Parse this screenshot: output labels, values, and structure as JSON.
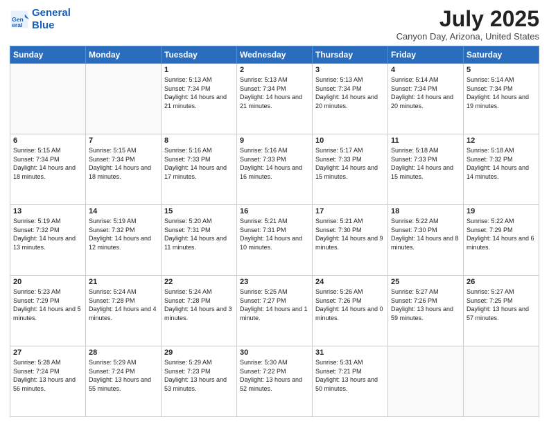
{
  "header": {
    "logo_line1": "General",
    "logo_line2": "Blue",
    "title": "July 2025",
    "subtitle": "Canyon Day, Arizona, United States"
  },
  "weekdays": [
    "Sunday",
    "Monday",
    "Tuesday",
    "Wednesday",
    "Thursday",
    "Friday",
    "Saturday"
  ],
  "weeks": [
    [
      {
        "day": "",
        "info": ""
      },
      {
        "day": "",
        "info": ""
      },
      {
        "day": "1",
        "info": "Sunrise: 5:13 AM\nSunset: 7:34 PM\nDaylight: 14 hours and 21 minutes."
      },
      {
        "day": "2",
        "info": "Sunrise: 5:13 AM\nSunset: 7:34 PM\nDaylight: 14 hours and 21 minutes."
      },
      {
        "day": "3",
        "info": "Sunrise: 5:13 AM\nSunset: 7:34 PM\nDaylight: 14 hours and 20 minutes."
      },
      {
        "day": "4",
        "info": "Sunrise: 5:14 AM\nSunset: 7:34 PM\nDaylight: 14 hours and 20 minutes."
      },
      {
        "day": "5",
        "info": "Sunrise: 5:14 AM\nSunset: 7:34 PM\nDaylight: 14 hours and 19 minutes."
      }
    ],
    [
      {
        "day": "6",
        "info": "Sunrise: 5:15 AM\nSunset: 7:34 PM\nDaylight: 14 hours and 18 minutes."
      },
      {
        "day": "7",
        "info": "Sunrise: 5:15 AM\nSunset: 7:34 PM\nDaylight: 14 hours and 18 minutes."
      },
      {
        "day": "8",
        "info": "Sunrise: 5:16 AM\nSunset: 7:33 PM\nDaylight: 14 hours and 17 minutes."
      },
      {
        "day": "9",
        "info": "Sunrise: 5:16 AM\nSunset: 7:33 PM\nDaylight: 14 hours and 16 minutes."
      },
      {
        "day": "10",
        "info": "Sunrise: 5:17 AM\nSunset: 7:33 PM\nDaylight: 14 hours and 15 minutes."
      },
      {
        "day": "11",
        "info": "Sunrise: 5:18 AM\nSunset: 7:33 PM\nDaylight: 14 hours and 15 minutes."
      },
      {
        "day": "12",
        "info": "Sunrise: 5:18 AM\nSunset: 7:32 PM\nDaylight: 14 hours and 14 minutes."
      }
    ],
    [
      {
        "day": "13",
        "info": "Sunrise: 5:19 AM\nSunset: 7:32 PM\nDaylight: 14 hours and 13 minutes."
      },
      {
        "day": "14",
        "info": "Sunrise: 5:19 AM\nSunset: 7:32 PM\nDaylight: 14 hours and 12 minutes."
      },
      {
        "day": "15",
        "info": "Sunrise: 5:20 AM\nSunset: 7:31 PM\nDaylight: 14 hours and 11 minutes."
      },
      {
        "day": "16",
        "info": "Sunrise: 5:21 AM\nSunset: 7:31 PM\nDaylight: 14 hours and 10 minutes."
      },
      {
        "day": "17",
        "info": "Sunrise: 5:21 AM\nSunset: 7:30 PM\nDaylight: 14 hours and 9 minutes."
      },
      {
        "day": "18",
        "info": "Sunrise: 5:22 AM\nSunset: 7:30 PM\nDaylight: 14 hours and 8 minutes."
      },
      {
        "day": "19",
        "info": "Sunrise: 5:22 AM\nSunset: 7:29 PM\nDaylight: 14 hours and 6 minutes."
      }
    ],
    [
      {
        "day": "20",
        "info": "Sunrise: 5:23 AM\nSunset: 7:29 PM\nDaylight: 14 hours and 5 minutes."
      },
      {
        "day": "21",
        "info": "Sunrise: 5:24 AM\nSunset: 7:28 PM\nDaylight: 14 hours and 4 minutes."
      },
      {
        "day": "22",
        "info": "Sunrise: 5:24 AM\nSunset: 7:28 PM\nDaylight: 14 hours and 3 minutes."
      },
      {
        "day": "23",
        "info": "Sunrise: 5:25 AM\nSunset: 7:27 PM\nDaylight: 14 hours and 1 minute."
      },
      {
        "day": "24",
        "info": "Sunrise: 5:26 AM\nSunset: 7:26 PM\nDaylight: 14 hours and 0 minutes."
      },
      {
        "day": "25",
        "info": "Sunrise: 5:27 AM\nSunset: 7:26 PM\nDaylight: 13 hours and 59 minutes."
      },
      {
        "day": "26",
        "info": "Sunrise: 5:27 AM\nSunset: 7:25 PM\nDaylight: 13 hours and 57 minutes."
      }
    ],
    [
      {
        "day": "27",
        "info": "Sunrise: 5:28 AM\nSunset: 7:24 PM\nDaylight: 13 hours and 56 minutes."
      },
      {
        "day": "28",
        "info": "Sunrise: 5:29 AM\nSunset: 7:24 PM\nDaylight: 13 hours and 55 minutes."
      },
      {
        "day": "29",
        "info": "Sunrise: 5:29 AM\nSunset: 7:23 PM\nDaylight: 13 hours and 53 minutes."
      },
      {
        "day": "30",
        "info": "Sunrise: 5:30 AM\nSunset: 7:22 PM\nDaylight: 13 hours and 52 minutes."
      },
      {
        "day": "31",
        "info": "Sunrise: 5:31 AM\nSunset: 7:21 PM\nDaylight: 13 hours and 50 minutes."
      },
      {
        "day": "",
        "info": ""
      },
      {
        "day": "",
        "info": ""
      }
    ]
  ]
}
